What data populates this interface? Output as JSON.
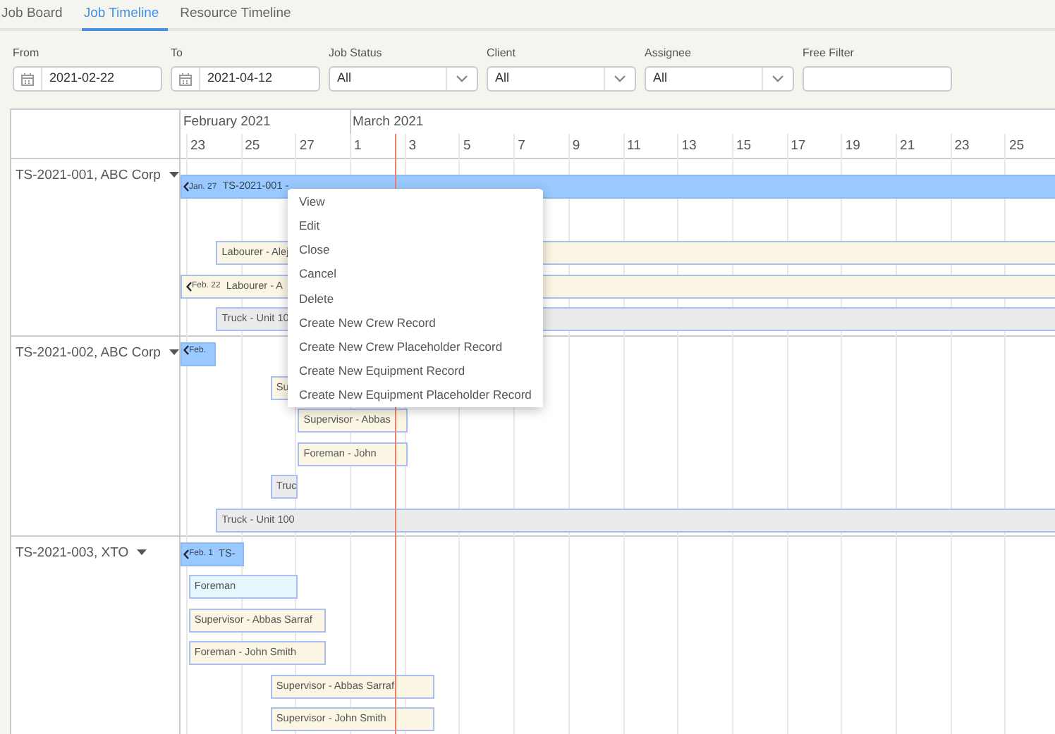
{
  "tabs": [
    {
      "label": "Job Board",
      "selected": false
    },
    {
      "label": "Job Timeline",
      "selected": true
    },
    {
      "label": "Resource Timeline",
      "selected": false
    }
  ],
  "filters": [
    {
      "label": "From",
      "kind": "date",
      "value": "2021-02-22"
    },
    {
      "label": "To",
      "kind": "date",
      "value": "2021-04-12"
    },
    {
      "label": "Job Status",
      "kind": "select",
      "value": "All"
    },
    {
      "label": "Client",
      "kind": "select",
      "value": "All"
    },
    {
      "label": "Assignee",
      "kind": "select",
      "value": "All"
    },
    {
      "label": "Free Filter",
      "kind": "text"
    }
  ],
  "timeline": {
    "months": [
      "February 2021",
      "March 2021"
    ],
    "days": [
      "23",
      "25",
      "27",
      "1",
      "3",
      "5",
      "7",
      "9",
      "11",
      "13",
      "15",
      "17",
      "19",
      "21",
      "23",
      "25"
    ],
    "jobs": [
      {
        "label": "TS-2021-001, ABC Corp",
        "bars": [
          {
            "kind": "job",
            "start_label": "Jan. 27",
            "text": "TS-2021-001 -"
          },
          {
            "kind": "gap"
          },
          {
            "kind": "crew",
            "text": "Labourer - Alej"
          },
          {
            "kind": "crew",
            "start_label": "Feb. 22",
            "text": "Labourer - A"
          },
          {
            "kind": "equipment",
            "text": "Truck - Unit 10"
          }
        ]
      },
      {
        "label": "TS-2021-002, ABC Corp",
        "bars": [
          {
            "kind": "job",
            "start_label": "Feb."
          },
          {
            "kind": "crew",
            "text": "Su"
          },
          {
            "kind": "crew",
            "text": "Supervisor - Abbas"
          },
          {
            "kind": "crew",
            "text": "Foreman - John"
          },
          {
            "kind": "equipment",
            "text": "Truc"
          },
          {
            "kind": "equipment",
            "text": "Truck - Unit 100"
          }
        ]
      },
      {
        "label": "TS-2021-003, XTO",
        "bars": [
          {
            "kind": "job",
            "start_label": "Feb. 1",
            "text": "TS-"
          },
          {
            "kind": "placeholder",
            "text": "Foreman"
          },
          {
            "kind": "crew",
            "text": "Supervisor - Abbas Sarraf"
          },
          {
            "kind": "crew",
            "text": "Foreman - John Smith"
          },
          {
            "kind": "crew",
            "text": "Supervisor - Abbas Sarraf"
          },
          {
            "kind": "crew",
            "text": "Supervisor - John Smith"
          }
        ]
      }
    ]
  },
  "context_menu": [
    "View",
    "Edit",
    "Close",
    "Cancel",
    "Delete",
    "Create New Crew Record",
    "Create New Crew Placeholder Record",
    "Create New Equipment Record",
    "Create New Equipment Placeholder Record"
  ]
}
